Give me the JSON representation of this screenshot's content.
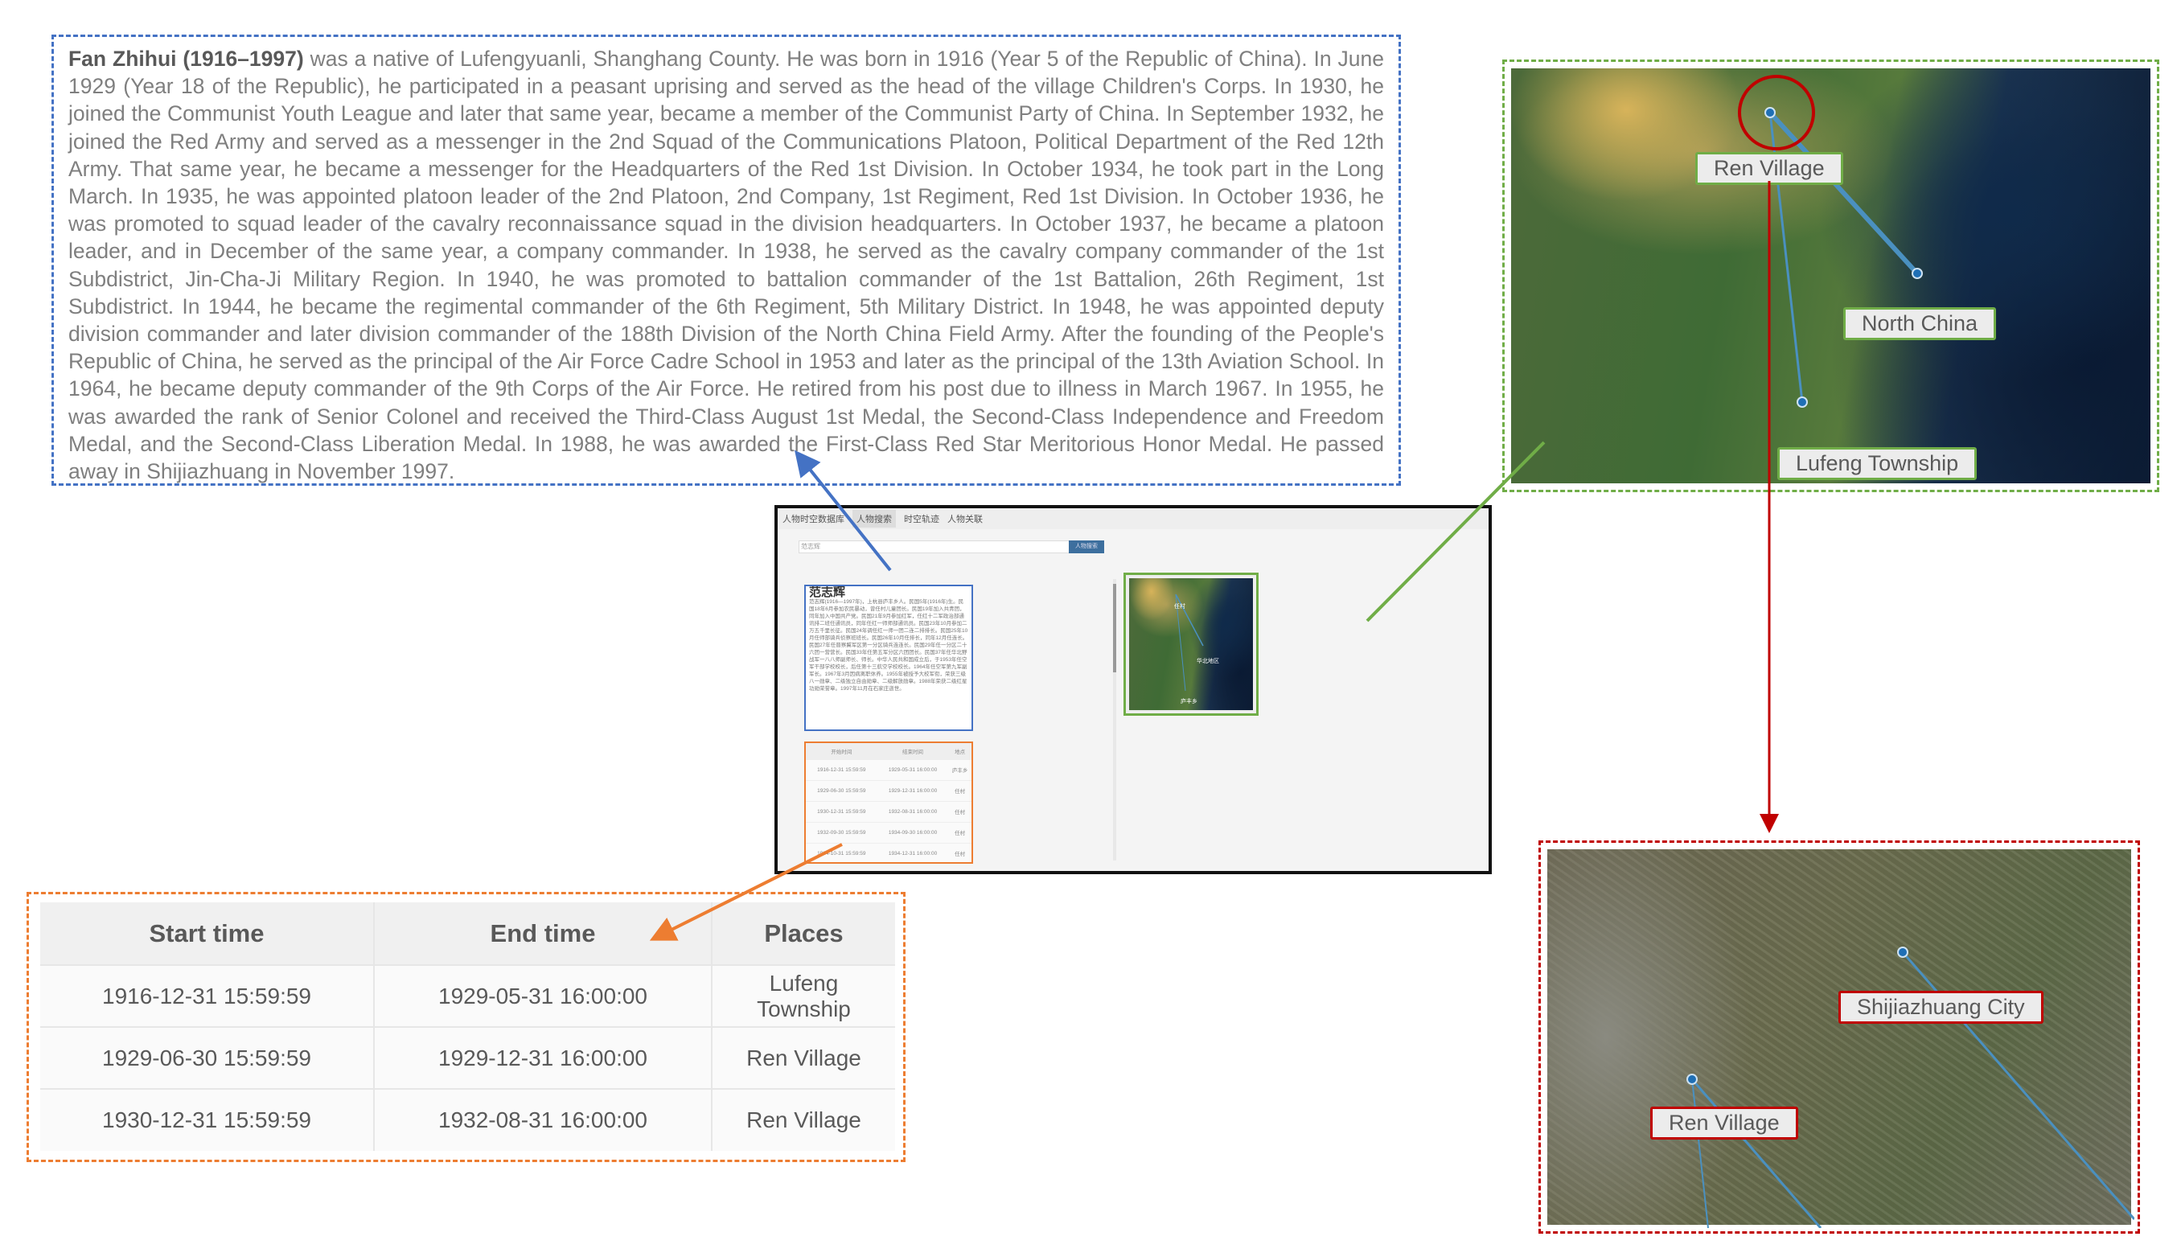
{
  "bio": {
    "name": "Fan Zhihui (1916–1997)",
    "text": " was a native of Lufengyuanli, Shanghang County. He was born in 1916 (Year 5 of the Republic of China). In June 1929 (Year 18 of the Republic), he participated in a peasant uprising and served as the head of the village Children's Corps. In 1930, he joined the Communist Youth League and later that same year, became a member of the Communist Party of China. In September 1932, he joined the Red Army and served as a messenger in the 2nd Squad of the Communications Platoon, Political Department of the Red 12th Army. That same year, he became a messenger for the Headquarters of the Red 1st Division. In October 1934, he took part in the Long March. In 1935, he was appointed platoon leader of the 2nd Platoon, 2nd Company, 1st Regiment, Red 1st Division. In October 1936, he was promoted to squad leader of the cavalry reconnaissance squad in the division headquarters. In October 1937, he became a platoon leader, and in December of the same year, a company commander. In 1938, he served as the cavalry company commander of the 1st Subdistrict, Jin-Cha-Ji Military Region. In 1940, he was promoted to battalion commander of the 1st Battalion, 26th Regiment, 1st Subdistrict. In 1944, he became the regimental commander of the 6th Regiment, 5th Military District. In 1948, he was appointed deputy division commander and later division commander of the 188th Division of the North China Field Army. After the founding of the People's Republic of China, he served as the principal of the Air Force Cadre School in 1953 and later as the principal of the 13th Aviation School. In 1964, he became deputy commander of the 9th Corps of the Air Force. He retired from his post due to illness in March 1967. In 1955, he was awarded the rank of Senior Colonel and received the Third-Class August 1st Medal, the Second-Class Independence and Freedom Medal, and the Second-Class Liberation Medal. In 1988, he was awarded the First-Class Red Star Meritorious Honor Medal. He passed away in Shijiazhuang in November 1997."
  },
  "map_overview": {
    "labels": [
      "Ren Village",
      "North China",
      "Lufeng Township"
    ]
  },
  "map_detail": {
    "labels": [
      "Shijiazhuang City",
      "Ren Village"
    ]
  },
  "table": {
    "headers": [
      "Start time",
      "End time",
      "Places"
    ],
    "rows": [
      [
        "1916-12-31 15:59:59",
        "1929-05-31 16:00:00",
        "Lufeng Township"
      ],
      [
        "1929-06-30 15:59:59",
        "1929-12-31 16:00:00",
        "Ren Village"
      ],
      [
        "1930-12-31 15:59:59",
        "1932-08-31 16:00:00",
        "Ren Village"
      ]
    ]
  },
  "app": {
    "title": "人物时空数据库",
    "tabs": [
      "人物搜索",
      "时空轨迹",
      "人物关联"
    ],
    "search_value": "范志辉",
    "search_button": "人物搜索",
    "bio_title": "范志辉",
    "bio_text": "范志辉(1916—1997年)，上杭县庐丰乡人。民国5年(1916年)生。民国18年6月参加农民暴动，曾任村儿童团长。民国19年加入共青团，同年加入中国共产党。民国21年9月参加红军，任红十二军政治部通讯排二班任通讯员，同年任红一师师部通讯员。民国23年10月参加二万五千里长征。民国24年调任红一师一团二连二排排长。民国25年10月任师部骑兵侦察班班长。民国26年10月任排长，同年12月任连长。民国27年任晋察冀军区第一分区骑兵连连长。民国29年任一分区二十六团一营营长。民国33年任第五军分区六团团长。民国37年任华北野战军一八八师副师长、师长。中华人民共和国成立后，于1953年任空军干部学校校长，后任第十三航空学校校长。1964年任空军第九军副军长。1967年3月因病离职休养。1955年被授予大校军衔，荣获三级八一勋章、二级独立自由勋章、二级解放勋章。1988年荣获二级红星功勋荣誉章。1997年11月在石家庄逝世。",
    "table_headers": [
      "开始时间",
      "结束时间",
      "地点"
    ],
    "table_rows": [
      [
        "1916-12-31 15:59:59",
        "1929-05-31 16:00:00",
        "庐丰乡"
      ],
      [
        "1929-06-30 15:59:59",
        "1929-12-31 16:00:00",
        "任村"
      ],
      [
        "1930-12-31 15:59:59",
        "1932-08-31 16:00:00",
        "任村"
      ],
      [
        "1932-09-30 15:59:59",
        "1934-09-30 16:00:00",
        "任村"
      ],
      [
        "1934-10-31 15:59:59",
        "1934-12-31 16:00:00",
        "任村"
      ]
    ],
    "map_labels": [
      "任村",
      "华北地区",
      "庐丰乡"
    ]
  },
  "colors": {
    "bio": "#4472c4",
    "map": "#70ad47",
    "table": "#ed7d31",
    "detail": "#c00000"
  }
}
